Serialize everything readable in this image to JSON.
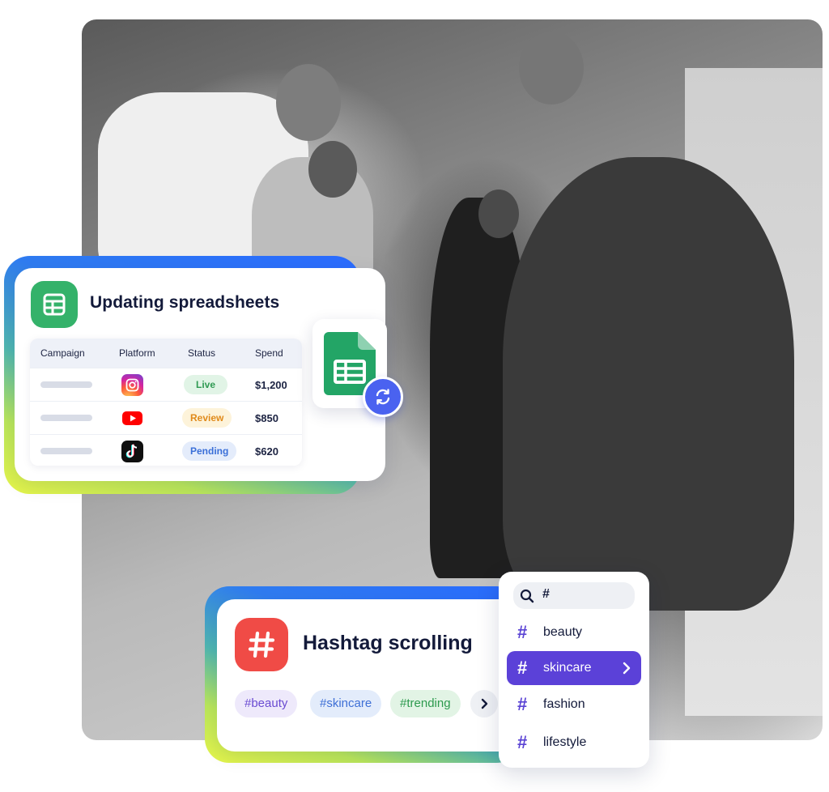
{
  "spreadsheet_card": {
    "title": "Updating spreadsheets",
    "columns": [
      "Campaign",
      "Platform",
      "Status",
      "Spend"
    ],
    "rows": [
      {
        "platform_icon": "instagram-icon",
        "status": "Live",
        "spend": "$1,200"
      },
      {
        "platform_icon": "youtube-icon",
        "status": "Review",
        "spend": "$850"
      },
      {
        "platform_icon": "tiktok-icon",
        "status": "Pending",
        "spend": "$620"
      }
    ],
    "status_colors": {
      "Live": "#2f9a52",
      "Review": "#e08a1a",
      "Pending": "#3a6fd8"
    }
  },
  "hashtag_card": {
    "title": "Hashtag scrolling",
    "tags": [
      "#beauty",
      "#skincare",
      "#trending"
    ]
  },
  "hashtag_dropdown": {
    "search_value": "#",
    "items": [
      "beauty",
      "skincare",
      "fashion",
      "lifestyle"
    ],
    "selected": "skincare"
  },
  "colors": {
    "sheets_green": "#34b26a",
    "hashtag_red": "#f04b46",
    "accent_purple": "#5b41d8",
    "sync_blue": "#4a62f0"
  }
}
